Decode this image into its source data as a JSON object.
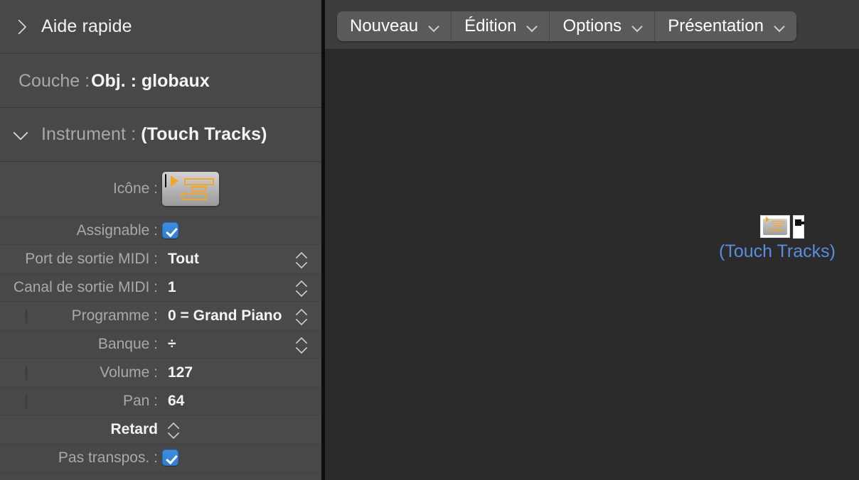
{
  "sidebar": {
    "quick_help": {
      "label": "Aide rapide",
      "chevron": "chevron-right-icon",
      "expanded": false
    },
    "breadcrumb": {
      "label": "Couche :",
      "value": "Obj. : globaux"
    },
    "instrument": {
      "label": "Instrument :",
      "value": "(Touch Tracks)",
      "chevron": "chevron-down-icon",
      "expanded": true
    },
    "params": [
      {
        "key": "icone",
        "label": "Icône :",
        "value": "",
        "type": "icon",
        "checkbox": null,
        "stepper": false
      },
      {
        "key": "assignable",
        "label": "Assignable :",
        "value": "",
        "type": "checkbox",
        "checkbox": "on",
        "stepper": false
      },
      {
        "key": "port_midi",
        "label": "Port de sortie MIDI :",
        "value": "Tout",
        "type": "text",
        "checkbox": null,
        "stepper": true
      },
      {
        "key": "canal_midi",
        "label": "Canal de sortie MIDI :",
        "value": "1",
        "type": "text",
        "checkbox": null,
        "stepper": true
      },
      {
        "key": "programme",
        "label": "Programme :",
        "value": "0 = Grand Piano",
        "type": "text",
        "checkbox": "off",
        "stepper": true
      },
      {
        "key": "banque",
        "label": "Banque :",
        "value": "÷",
        "type": "text",
        "checkbox": null,
        "stepper": true
      },
      {
        "key": "volume",
        "label": "Volume :",
        "value": "127",
        "type": "text",
        "checkbox": "off",
        "stepper": false
      },
      {
        "key": "pan",
        "label": "Pan :",
        "value": "64",
        "type": "text",
        "checkbox": "off",
        "stepper": false
      },
      {
        "key": "retard",
        "label": "Retard",
        "value": "",
        "type": "inline-stepper",
        "checkbox": null,
        "stepper": true
      },
      {
        "key": "pas_transpos",
        "label": "Pas transpos. :",
        "value": "",
        "type": "checkbox",
        "checkbox": "on",
        "stepper": false
      }
    ]
  },
  "menubar": {
    "items": [
      {
        "label": "Nouveau",
        "chevron": "chevron-down-icon"
      },
      {
        "label": "Édition",
        "chevron": "chevron-down-icon"
      },
      {
        "label": "Options",
        "chevron": "chevron-down-icon"
      },
      {
        "label": "Présentation",
        "chevron": "chevron-down-icon"
      }
    ]
  },
  "canvas": {
    "object": {
      "label": "(Touch Tracks)",
      "icon": "midi-instrument-icon",
      "port": "midi-port-icon"
    }
  },
  "colors": {
    "sidebar_bg": "#484848",
    "row_bg": "#4a4a4a",
    "canvas_bg": "#2b2b2b",
    "menubar_bg": "#3d3d3d",
    "menu_button_bg": "#5a5a5a",
    "accent_checkbox": "#3a8ee0",
    "object_label": "#5b8ce0",
    "icon_orange": "#f5a623",
    "label_grey": "#a9a9a9",
    "value_white": "#f4f4f4"
  }
}
